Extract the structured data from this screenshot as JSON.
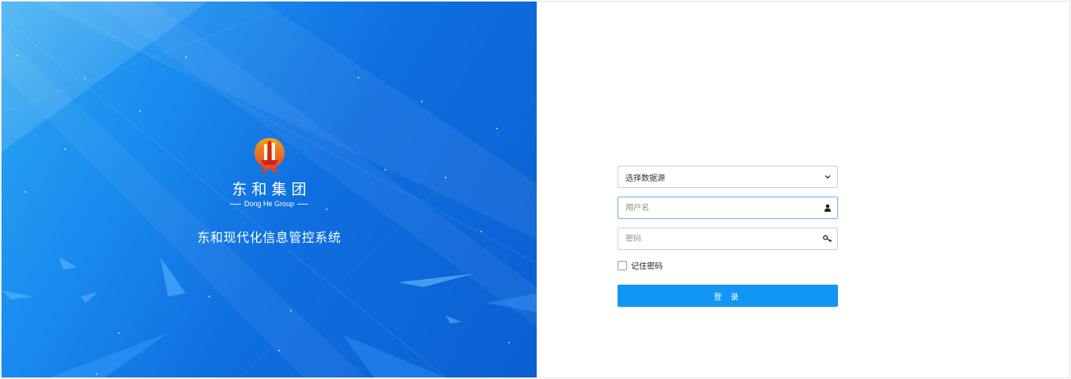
{
  "brand": {
    "company_cn": "东和集团",
    "company_en": "Dong He Group",
    "system_title": "东和现代化信息管控系统",
    "logo_icon": "dong-he-logo",
    "colors": {
      "hero_blue": "#0f6fe0",
      "logo_red": "#e03a2a",
      "logo_gold": "#f2a01e"
    }
  },
  "login": {
    "datasource_select": {
      "selected": "选择数据源",
      "icon": "chevron-down-icon"
    },
    "username": {
      "placeholder": "用户名",
      "value": "",
      "icon": "user-icon"
    },
    "password": {
      "placeholder": "密码",
      "value": "",
      "icon": "key-icon"
    },
    "remember_label": "记住密码",
    "remember_checked": false,
    "submit_label": "登 录",
    "colors": {
      "button": "#1296f5",
      "focus_border": "#86b7f5"
    }
  }
}
